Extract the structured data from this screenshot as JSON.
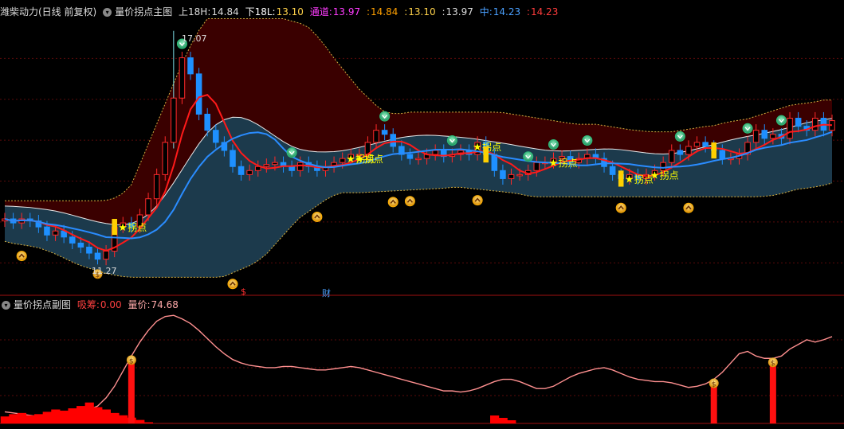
{
  "main_header": {
    "stock": "潍柴动力(日线 前复权)",
    "indicator": "量价拐点主图",
    "upper_label": "上18H:",
    "upper_value": "14.84",
    "lower_label": "下18L:",
    "lower_value": "13.10",
    "channel_label": "通道:",
    "channel_v1": "13.97",
    "channel_v2": "14.84",
    "channel_v3": "13.10",
    "channel_v4": "13.97",
    "mid_label": "中:",
    "mid_v1": "14.23",
    "mid_v2": "14.23"
  },
  "sub_header": {
    "indicator": "量价拐点副图",
    "absorb_label": "吸筹:",
    "absorb_value": "0.00",
    "volprice_label": "量价:",
    "volprice_value": "74.68"
  },
  "markers": {
    "high_price": "17.07",
    "low_price": "11.27",
    "pivot_text": "拐点",
    "finance_text": "财",
    "dollar_text": "$"
  },
  "colors": {
    "up": "#ff2a2a",
    "down": "#1e90ff",
    "band_outer": "#3a0000",
    "band_inner": "#1c3a4c",
    "ma_red": "#ff1a1a",
    "ma_blue": "#2a8cff",
    "pivot": "#ffff00",
    "volprice_line": "#ff9090",
    "absorb_bar": "#ff0000"
  },
  "chart_data": [
    {
      "type": "candlestick",
      "high_label": "17.07",
      "low_label": "11.27",
      "ylim": [
        10.8,
        17.4
      ],
      "series": [
        {
          "name": "上18H",
          "last": 14.84
        },
        {
          "name": "下18L",
          "last": 13.1
        },
        {
          "name": "中",
          "last": 14.23
        }
      ],
      "closes": [
        12.4,
        12.3,
        12.4,
        12.35,
        12.2,
        12.0,
        12.1,
        11.95,
        11.8,
        11.7,
        11.55,
        11.4,
        11.6,
        12.2,
        12.3,
        12.2,
        12.5,
        12.9,
        13.5,
        14.3,
        15.4,
        16.4,
        16.0,
        15.0,
        14.6,
        14.3,
        14.1,
        13.7,
        13.5,
        13.6,
        13.7,
        13.75,
        13.8,
        13.7,
        13.6,
        13.8,
        13.7,
        13.6,
        13.7,
        13.8,
        13.9,
        14.0,
        14.0,
        14.3,
        14.6,
        14.5,
        14.2,
        14.0,
        13.9,
        13.9,
        14.0,
        14.1,
        13.95,
        14.0,
        14.1,
        14.0,
        14.3,
        14.0,
        13.6,
        13.4,
        13.5,
        13.5,
        13.6,
        13.8,
        13.8,
        13.9,
        13.95,
        13.8,
        13.9,
        14.0,
        13.9,
        13.7,
        13.5,
        13.4,
        13.5,
        13.4,
        13.5,
        13.6,
        13.8,
        14.1,
        14.0,
        14.2,
        14.3,
        14.2,
        14.1,
        13.9,
        13.9,
        14.0,
        14.3,
        14.6,
        14.4,
        14.5,
        14.4,
        14.9,
        14.7,
        14.6,
        14.9,
        14.6,
        14.84
      ],
      "volprice": [
        10,
        9,
        8,
        7,
        6,
        6,
        7,
        8,
        9,
        10,
        12,
        15,
        22,
        32,
        45,
        58,
        70,
        80,
        88,
        92,
        93,
        90,
        86,
        80,
        73,
        66,
        60,
        55,
        52,
        50,
        49,
        48,
        48,
        49,
        49,
        48,
        47,
        46,
        46,
        47,
        48,
        49,
        48,
        46,
        44,
        42,
        40,
        38,
        36,
        34,
        32,
        30,
        28,
        28,
        27,
        28,
        30,
        33,
        36,
        38,
        38,
        36,
        33,
        30,
        30,
        32,
        36,
        40,
        43,
        45,
        47,
        48,
        46,
        43,
        40,
        38,
        37,
        36,
        36,
        35,
        33,
        31,
        32,
        34,
        38,
        44,
        52,
        60,
        62,
        58,
        56,
        56,
        58,
        64,
        68,
        72,
        70,
        72,
        74.68
      ],
      "absorb": [
        6,
        8,
        9,
        7,
        8,
        10,
        12,
        11,
        13,
        15,
        18,
        14,
        12,
        9,
        7,
        5,
        3,
        1,
        0,
        0,
        0,
        0,
        0,
        0,
        0,
        0,
        0,
        0,
        0,
        0,
        0,
        0,
        0,
        0,
        0,
        0,
        0,
        0,
        0,
        0,
        0,
        0,
        0,
        0,
        0,
        0,
        0,
        0,
        0,
        0,
        0,
        0,
        0,
        0,
        0,
        0,
        0,
        0,
        0,
        0,
        0,
        0,
        0,
        0,
        0,
        0,
        0,
        0,
        0,
        0,
        0,
        0,
        0,
        0,
        0,
        0,
        0,
        0,
        0,
        0,
        0,
        0,
        0,
        0,
        0,
        0,
        0,
        0,
        0,
        0,
        0,
        0,
        0,
        0,
        0,
        0,
        0,
        0,
        0
      ]
    }
  ]
}
